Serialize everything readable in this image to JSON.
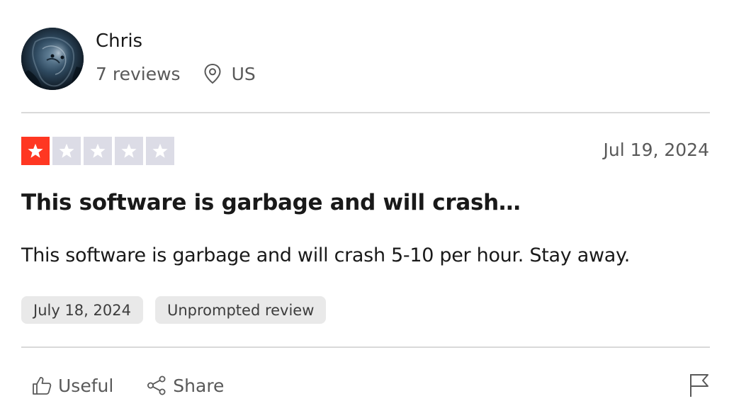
{
  "reviewer": {
    "name": "Chris",
    "reviews_count": "7 reviews",
    "location": "US",
    "avatar_icon": "portrait-avatar"
  },
  "rating": {
    "value": 1,
    "max": 5,
    "filled_color": "#ff3722",
    "empty_color": "#dcdce6"
  },
  "review": {
    "date": "Jul 19, 2024",
    "title": "This software is garbage and will crash…",
    "body": "This software is garbage and will crash 5-10 per hour. Stay away.",
    "tags": [
      "July 18, 2024",
      "Unprompted review"
    ]
  },
  "actions": {
    "useful_label": "Useful",
    "share_label": "Share",
    "useful_icon": "thumbs-up-icon",
    "share_icon": "share-icon",
    "report_icon": "flag-icon"
  }
}
